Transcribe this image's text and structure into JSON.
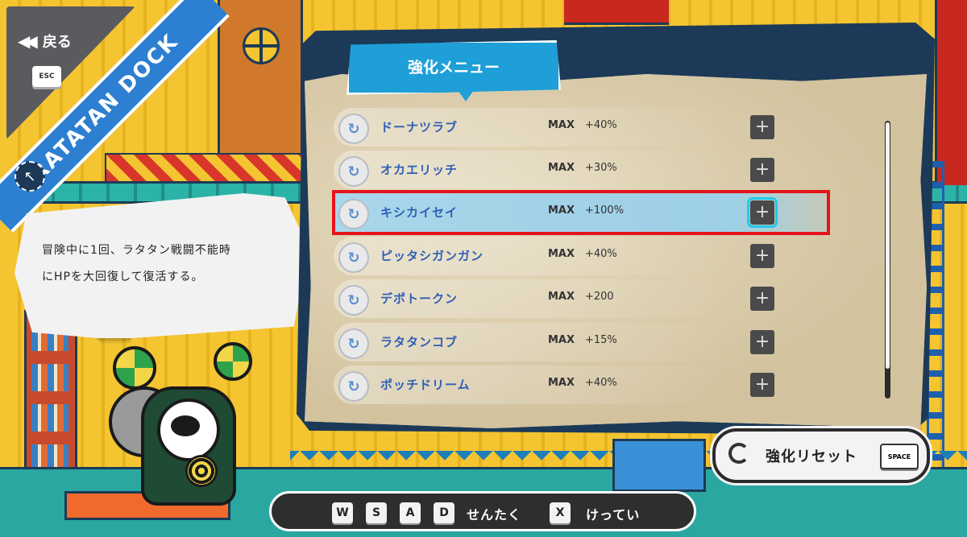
{
  "header": {
    "back_label": "戻る",
    "esc_key": "ESC",
    "location_banner": "RATATAN DOCK"
  },
  "menu": {
    "title": "強化メニュー",
    "items": [
      {
        "icon": "refresh-icon",
        "name": "ドーナツラブ",
        "level": "MAX",
        "bonus": "+40%",
        "selected": false
      },
      {
        "icon": "refresh-icon",
        "name": "オカエリッチ",
        "level": "MAX",
        "bonus": "+30%",
        "selected": false
      },
      {
        "icon": "refresh-icon",
        "name": "キシカイセイ",
        "level": "MAX",
        "bonus": "+100%",
        "selected": true
      },
      {
        "icon": "refresh-icon",
        "name": "ピッタシガンガン",
        "level": "MAX",
        "bonus": "+40%",
        "selected": false
      },
      {
        "icon": "refresh-icon",
        "name": "デポトークン",
        "level": "MAX",
        "bonus": "+200",
        "selected": false
      },
      {
        "icon": "refresh-icon",
        "name": "ラタタンコブ",
        "level": "MAX",
        "bonus": "+15%",
        "selected": false
      },
      {
        "icon": "refresh-icon",
        "name": "ポッチドリーム",
        "level": "MAX",
        "bonus": "+40%",
        "selected": false
      }
    ],
    "plus_label": "+"
  },
  "description": {
    "line1": "冒険中に1回、ラタタン戦闘不能時",
    "line2": "にHPを大回復して復活する。"
  },
  "reset": {
    "label": "強化リセット",
    "key": "SPACE"
  },
  "controls": {
    "keys": [
      "W",
      "S",
      "A",
      "D"
    ],
    "select_label": "せんたく",
    "confirm_key": "X",
    "confirm_label": "けってい"
  },
  "colors": {
    "accent_blue": "#1e9fd8",
    "selection_red": "#e4141a",
    "item_name": "#2d5fb5",
    "frame_navy": "#1c3a57"
  }
}
